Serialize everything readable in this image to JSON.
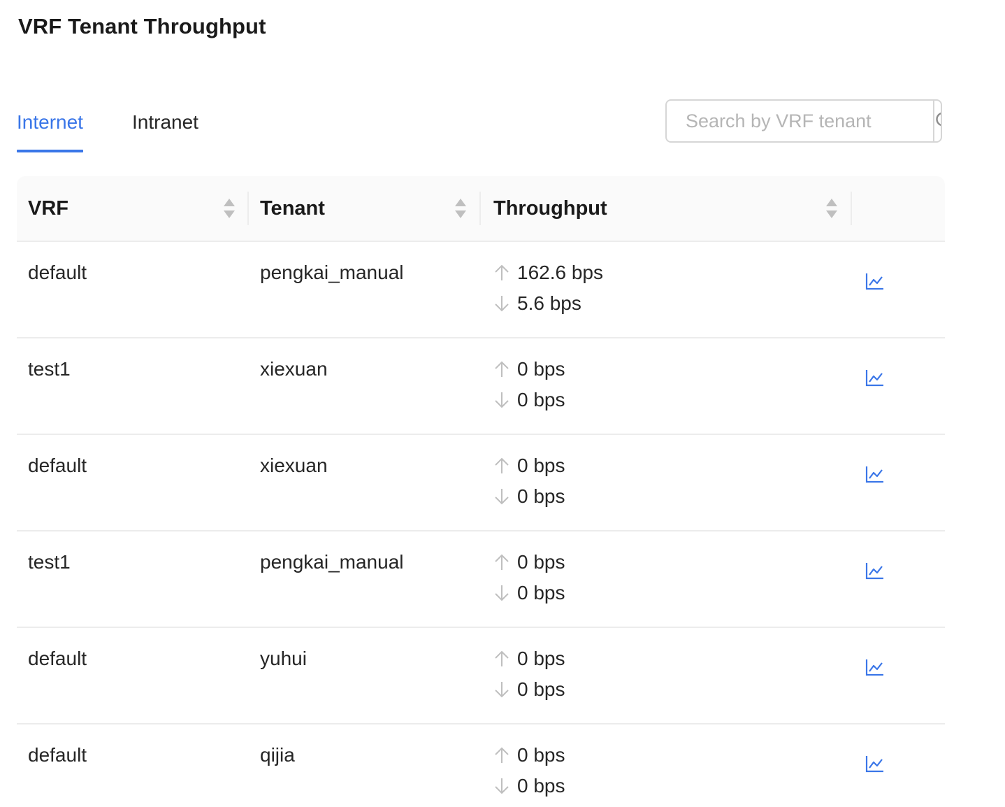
{
  "page": {
    "title": "VRF Tenant Throughput"
  },
  "tabs": [
    {
      "label": "Internet",
      "active": true
    },
    {
      "label": "Intranet",
      "active": false
    }
  ],
  "search": {
    "placeholder": "Search by VRF tenant",
    "value": ""
  },
  "table": {
    "columns": {
      "vrf": "VRF",
      "tenant": "Tenant",
      "throughput": "Throughput"
    },
    "rows": [
      {
        "vrf": "default",
        "tenant": "pengkai_manual",
        "up": "162.6 bps",
        "down": "5.6 bps"
      },
      {
        "vrf": "test1",
        "tenant": "xiexuan",
        "up": "0 bps",
        "down": "0 bps"
      },
      {
        "vrf": "default",
        "tenant": "xiexuan",
        "up": "0 bps",
        "down": "0 bps"
      },
      {
        "vrf": "test1",
        "tenant": "pengkai_manual",
        "up": "0 bps",
        "down": "0 bps"
      },
      {
        "vrf": "default",
        "tenant": "yuhui",
        "up": "0 bps",
        "down": "0 bps"
      },
      {
        "vrf": "default",
        "tenant": "qijia",
        "up": "0 bps",
        "down": "0 bps"
      }
    ]
  },
  "icons": {
    "arrow_up": "arrow-up-icon",
    "arrow_down": "arrow-down-icon",
    "chart": "line-chart-icon",
    "search": "search-icon",
    "sort": "sort-icon"
  },
  "colors": {
    "accent": "#3a76e8",
    "muted": "#bfbfbf",
    "border": "#ececec"
  }
}
